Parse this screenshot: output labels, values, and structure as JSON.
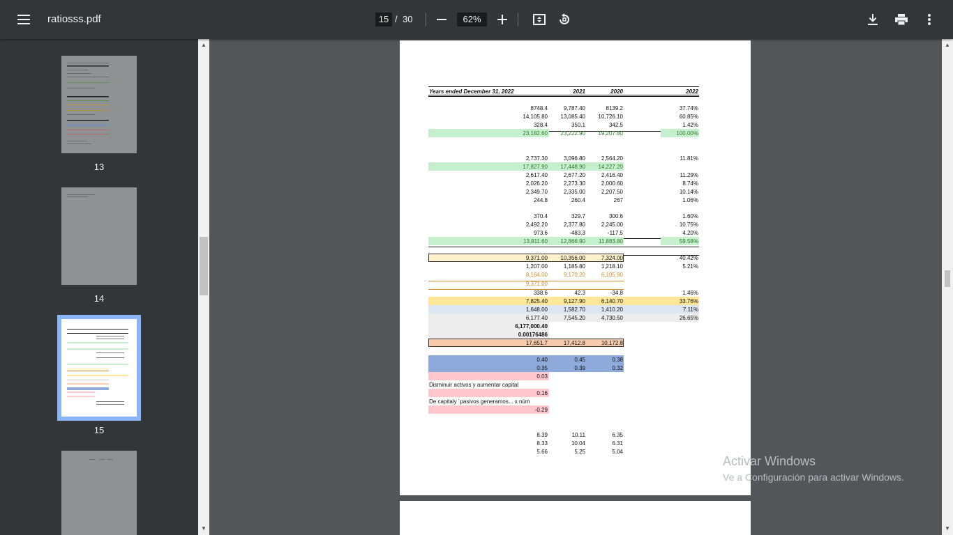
{
  "toolbar": {
    "file_name": "ratiosss.pdf",
    "current_page": "15",
    "page_separator": "/",
    "total_pages": "30",
    "zoom": "62%"
  },
  "thumbnails": [
    {
      "label": "13"
    },
    {
      "label": "14"
    },
    {
      "label": "15",
      "selected": true
    }
  ],
  "watermark": {
    "line1": "Activar Windows",
    "line2": "Ve a Configuración para activar Windows."
  },
  "document": {
    "header": {
      "title": "Years ended December 31, 2022",
      "col1": "2021",
      "col2": "2020",
      "col3": "2022"
    },
    "rows": [
      {
        "a": "8748.4",
        "b": "9,787.40",
        "c": "8139.2",
        "d": "37.74%"
      },
      {
        "a": "14,105.80",
        "b": "13,085.40",
        "c": "10,726.10",
        "d": "60.85%"
      },
      {
        "a": "328.4",
        "b": "350.1",
        "c": "342.5",
        "d": "1.42%"
      },
      {
        "a": "23,182.60",
        "b": "23,222.90",
        "c": "19,207.80",
        "d": "100.00%"
      },
      {
        "a": "2,737.30",
        "b": "3,096.80",
        "c": "2,564.20",
        "d": "11.81%"
      },
      {
        "a": "17,827.90",
        "b": "17,448.90",
        "c": "14,227.20",
        "d": ""
      },
      {
        "a": "2,617.40",
        "b": "2,677.20",
        "c": "2,416.40",
        "d": "11.29%"
      },
      {
        "a": "2,026.20",
        "b": "2,273.30",
        "c": "2,000.60",
        "d": "8.74%"
      },
      {
        "a": "2,349.70",
        "b": "2,335.00",
        "c": "2,207.50",
        "d": "10.14%"
      },
      {
        "a": "244.8",
        "b": "260.4",
        "c": "267",
        "d": "1.06%"
      },
      {
        "a": "370.4",
        "b": "329.7",
        "c": "300.6",
        "d": "1.60%"
      },
      {
        "a": "2,492.20",
        "b": "2,377.80",
        "c": "2,245.00",
        "d": "10.75%"
      },
      {
        "a": "973.6",
        "b": "-483.3",
        "c": "-117.5",
        "d": "4.20%"
      },
      {
        "a": "13,811.60",
        "b": "12,866.90",
        "c": "11,883.80",
        "d": "59.58%"
      },
      {
        "a": "9,371.00",
        "b": "10,356.00",
        "c": "7,324.00",
        "d": "40.42%"
      },
      {
        "a": "1,207.00",
        "b": "1,185.80",
        "c": "1,218.10",
        "d": "5.21%"
      },
      {
        "a": "8,164.00",
        "b": "9,170.20",
        "c": "6,105.90",
        "d": ""
      },
      {
        "a": "9,371.00",
        "b": "",
        "c": "",
        "d": ""
      },
      {
        "a": "338.6",
        "b": "42.3",
        "c": "-34.8",
        "d": "1.46%"
      },
      {
        "a": "7,825.40",
        "b": "9,127.90",
        "c": "6,140.70",
        "d": "33.76%"
      },
      {
        "a": "1,648.00",
        "b": "1,582.70",
        "c": "1,410.20",
        "d": "7.11%"
      },
      {
        "a": "6,177.40",
        "b": "7,545.20",
        "c": "4,730.50",
        "d": "26.65%"
      },
      {
        "a": "6,177,000.40",
        "b": "",
        "c": "",
        "d": ""
      },
      {
        "a": "0.00176486",
        "b": "",
        "c": "",
        "d": ""
      },
      {
        "a": "17,651.7",
        "b": "17,412.8",
        "c": "10,172.8",
        "d": ""
      },
      {
        "a": "0.40",
        "b": "0.45",
        "c": "0.38",
        "d": ""
      },
      {
        "a": "0.35",
        "b": "0.39",
        "c": "0.32",
        "d": ""
      },
      {
        "a": "0.03",
        "b": "",
        "c": "",
        "d": ""
      },
      {
        "a": "0.16",
        "b": "",
        "c": "",
        "d": ""
      },
      {
        "a": "-0.29",
        "b": "",
        "c": "",
        "d": ""
      },
      {
        "a": "8.39",
        "b": "10.11",
        "c": "6.35",
        "d": ""
      },
      {
        "a": "8.33",
        "b": "10.04",
        "c": "6.31",
        "d": ""
      },
      {
        "a": "5.66",
        "b": "5.25",
        "c": "5.04",
        "d": ""
      }
    ],
    "note1": "Disminuir activos y aumentar capital",
    "note2": "De capitaly ´pasivos generamos... x núm"
  },
  "colors": {
    "green_fill": "#c6efce",
    "yellow_fill": "#fff2cc",
    "gold_fill": "#ffe699",
    "blue_fill": "#8eaadb",
    "light_blue_fill": "#dde6f2",
    "gray_fill": "#ededed",
    "orange_fill": "#f8cbad",
    "pink_fill": "#ffc7ce",
    "selected_thumb": "#8ab4f8"
  }
}
